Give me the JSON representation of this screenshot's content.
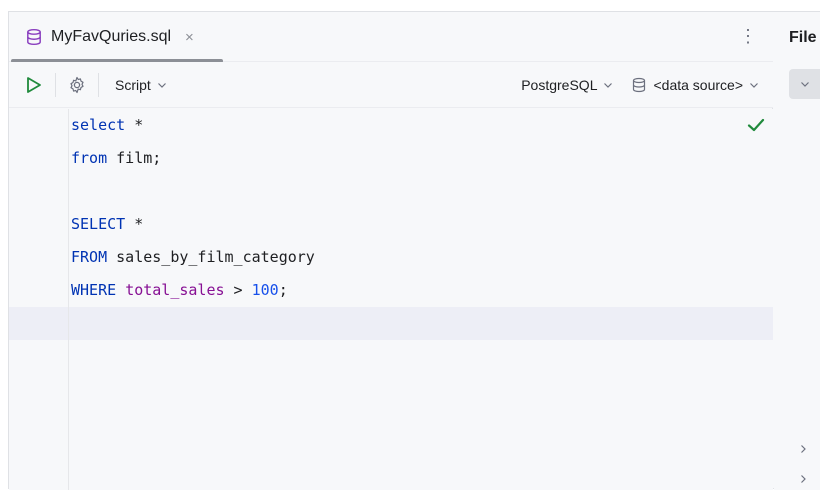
{
  "tab": {
    "title": "MyFavQuries.sql",
    "close_label": "×",
    "icon": "database-icon"
  },
  "toolbar": {
    "run_icon": "play-icon",
    "settings_icon": "gear-icon",
    "script_label": "Script",
    "dialect_label": "PostgreSQL",
    "datasource_label": "<data source>"
  },
  "editor": {
    "lines": [
      [
        {
          "t": "select",
          "c": "kw"
        },
        {
          "t": " *",
          "c": ""
        }
      ],
      [
        {
          "t": "from",
          "c": "kw"
        },
        {
          "t": " film;",
          "c": ""
        }
      ],
      [],
      [
        {
          "t": "SELECT",
          "c": "kw"
        },
        {
          "t": " *",
          "c": ""
        }
      ],
      [
        {
          "t": "FROM",
          "c": "kw"
        },
        {
          "t": " sales_by_film_category",
          "c": ""
        }
      ],
      [
        {
          "t": "WHERE",
          "c": "kw"
        },
        {
          "t": " ",
          "c": ""
        },
        {
          "t": "total_sales",
          "c": "ident"
        },
        {
          "t": " > ",
          "c": ""
        },
        {
          "t": "100",
          "c": "num"
        },
        {
          "t": ";",
          "c": ""
        }
      ],
      []
    ],
    "status_icon": "check-icon"
  },
  "side_panel": {
    "title": "File"
  },
  "colors": {
    "accent_green": "#208a3c",
    "keyword": "#0033b3",
    "identifier": "#871094",
    "number": "#1750eb"
  }
}
